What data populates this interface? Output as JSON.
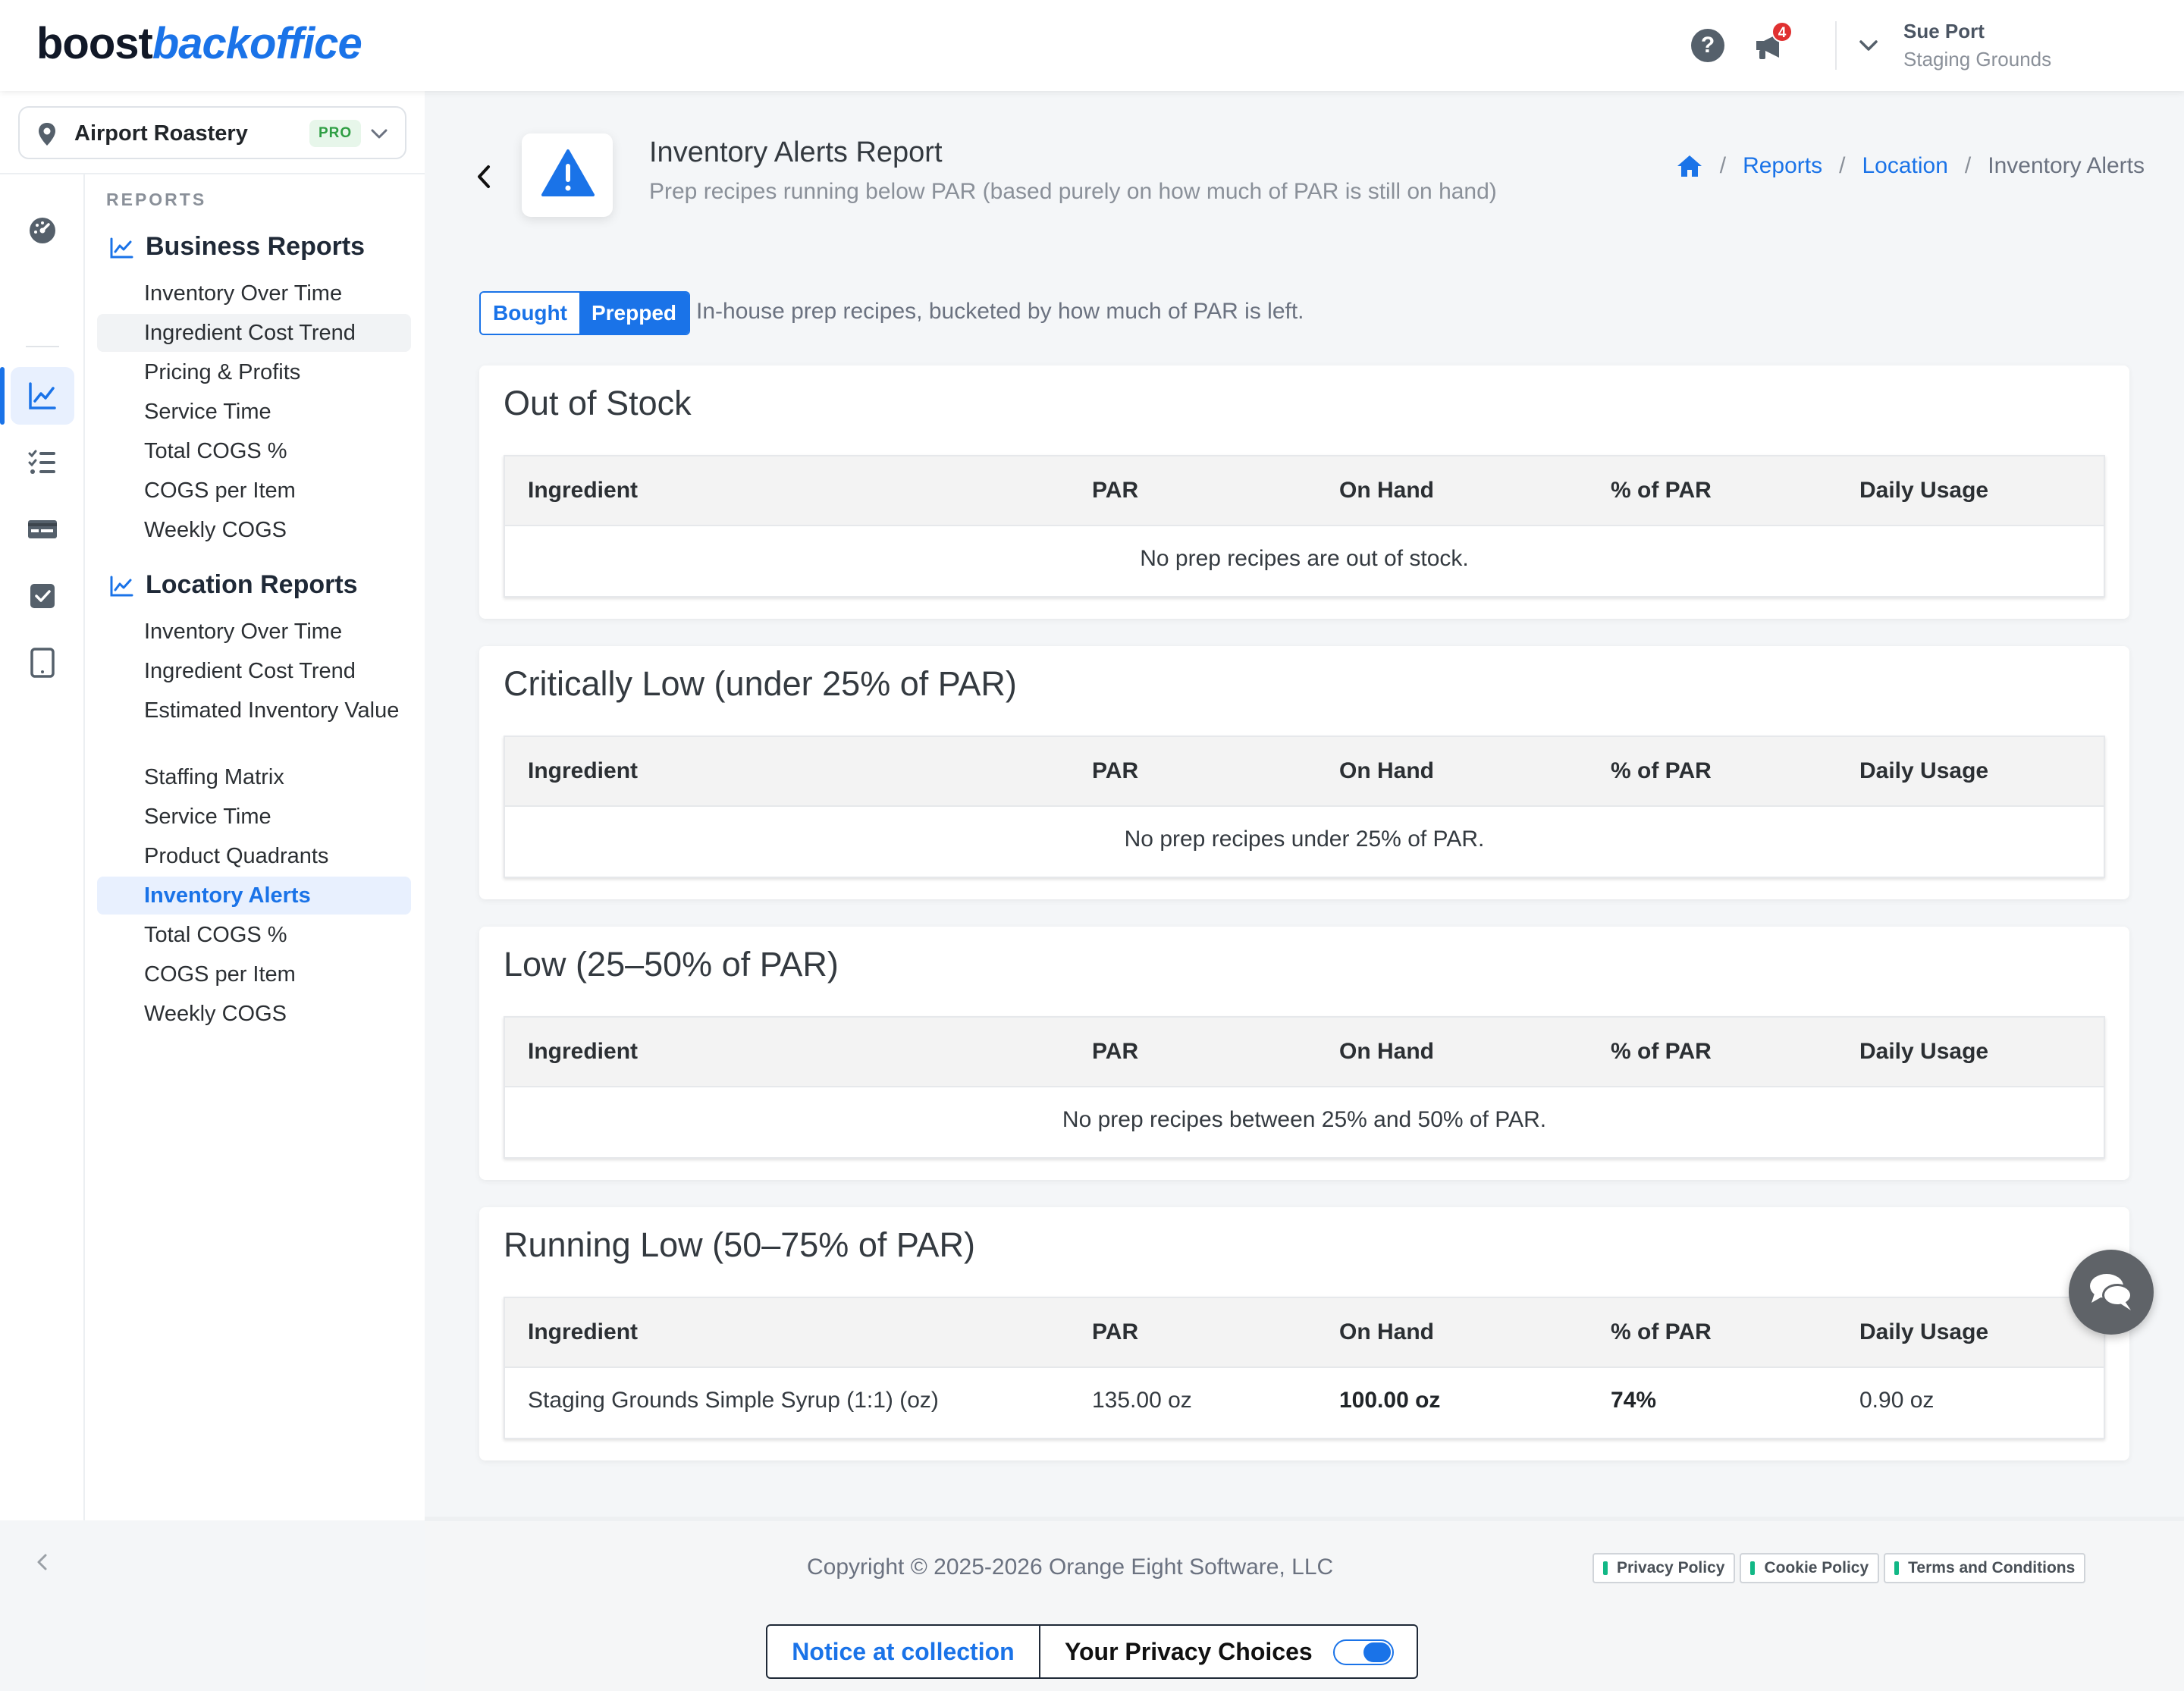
{
  "header": {
    "logo_part1": "boost",
    "logo_part2": "backoffice",
    "notification_count": "4",
    "user_name": "Sue Port",
    "user_org": "Staging Grounds",
    "icons": [
      "help-icon",
      "announcement-icon",
      "chevron-down-icon"
    ]
  },
  "sidebar": {
    "location_name": "Airport Roastery",
    "location_badge": "PRO",
    "rail_icons": [
      "dashboard-icon",
      "reports-chart-icon",
      "checklist-icon",
      "card-terminal-icon",
      "checkbox-icon",
      "tablet-icon"
    ],
    "menu_label": "REPORTS",
    "business_section": "Business Reports",
    "business_items": [
      "Inventory Over Time",
      "Ingredient Cost Trend",
      "Pricing & Profits",
      "Service Time",
      "Total COGS %",
      "COGS per Item",
      "Weekly COGS"
    ],
    "location_section": "Location Reports",
    "location_items": [
      "Inventory Over Time",
      "Ingredient Cost Trend",
      "Estimated Inventory Value",
      "Staffing Matrix",
      "Service Time",
      "Product Quadrants",
      "Inventory Alerts",
      "Total COGS %",
      "COGS per Item",
      "Weekly COGS"
    ]
  },
  "page": {
    "title": "Inventory Alerts Report",
    "subtitle": "Prep recipes running below PAR (based purely on how much of PAR is still on hand)",
    "breadcrumb": [
      "Reports",
      "Location",
      "Inventory Alerts"
    ],
    "toggle_bought": "Bought",
    "toggle_prepped": "Prepped",
    "toggle_description": "In-house prep recipes, bucketed by how much of PAR is left."
  },
  "table_headers": [
    "Ingredient",
    "PAR",
    "On Hand",
    "% of PAR",
    "Daily Usage"
  ],
  "sections": [
    {
      "title": "Out of Stock",
      "empty_message": "No prep recipes are out of stock."
    },
    {
      "title": "Critically Low (under 25% of PAR)",
      "empty_message": "No prep recipes under 25% of PAR."
    },
    {
      "title": "Low (25–50% of PAR)",
      "empty_message": "No prep recipes between 25% and 50% of PAR."
    },
    {
      "title": "Running Low (50–75% of PAR)",
      "rows": [
        {
          "ingredient": "Staging Grounds Simple Syrup (1:1) (oz)",
          "par": "135.00 oz",
          "on_hand": "100.00 oz",
          "pct_par": "74%",
          "daily_usage": "0.90 oz"
        }
      ]
    }
  ],
  "footer": {
    "copyright": "Copyright © 2025-2026 Orange Eight Software, LLC",
    "links": [
      "Privacy Policy",
      "Cookie Policy",
      "Terms and Conditions"
    ],
    "notice": "Notice at collection",
    "choices": "Your Privacy Choices"
  },
  "colors": {
    "accent": "#1a73e8",
    "pro_badge": "#2f9e44",
    "alert": "#1a73e8"
  }
}
